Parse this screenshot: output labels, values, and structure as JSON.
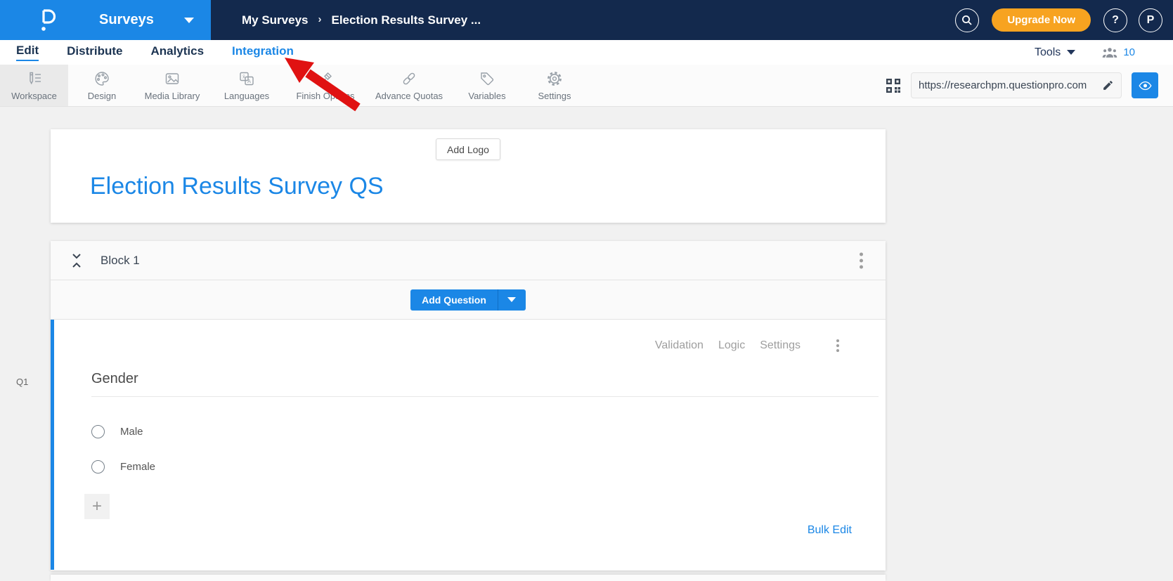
{
  "colors": {
    "brand_blue": "#1B87E6",
    "topbar_navy": "#13294D",
    "upgrade_orange": "#F7A320",
    "arrow_red": "#E01212",
    "page_bg": "#F1F1F1"
  },
  "topbar": {
    "product_label": "Surveys",
    "breadcrumb": {
      "item1": "My Surveys",
      "separator": "›",
      "item2": "Election Results Survey ..."
    },
    "upgrade_label": "Upgrade Now",
    "help_label": "?",
    "avatar_initial": "P"
  },
  "nav_tabs": {
    "items": [
      {
        "label": "Edit",
        "state": "active"
      },
      {
        "label": "Distribute",
        "state": "default"
      },
      {
        "label": "Analytics",
        "state": "default"
      },
      {
        "label": "Integration",
        "state": "highlighted"
      }
    ],
    "tools_label": "Tools",
    "collaborators_count": "10"
  },
  "toolbar": {
    "items": [
      {
        "label": "Workspace",
        "icon": "workspace-icon",
        "active": true
      },
      {
        "label": "Design",
        "icon": "design-icon",
        "active": false
      },
      {
        "label": "Media Library",
        "icon": "media-library-icon",
        "active": false
      },
      {
        "label": "Languages",
        "icon": "languages-icon",
        "active": false
      },
      {
        "label": "Finish Options",
        "icon": "finish-options-icon",
        "active": false
      },
      {
        "label": "Advance Quotas",
        "icon": "advance-quotas-icon",
        "active": false
      },
      {
        "label": "Variables",
        "icon": "variables-icon",
        "active": false
      },
      {
        "label": "Settings",
        "icon": "settings-icon",
        "active": false
      }
    ],
    "survey_url": "https://researchpm.questionpro.com"
  },
  "survey_header": {
    "add_logo_label": "Add Logo",
    "title": "Election Results Survey QS"
  },
  "block": {
    "title": "Block 1",
    "add_question_label": "Add Question"
  },
  "question": {
    "code": "Q1",
    "text": "Gender",
    "actions": [
      {
        "label": "Validation"
      },
      {
        "label": "Logic"
      },
      {
        "label": "Settings"
      }
    ],
    "choices": [
      {
        "label": "Male"
      },
      {
        "label": "Female"
      }
    ],
    "add_choice_label": "+",
    "bulk_edit_label": "Bulk Edit"
  },
  "annotation": {
    "shape": "arrow",
    "color": "#E01212",
    "points_to": "Integration tab"
  }
}
